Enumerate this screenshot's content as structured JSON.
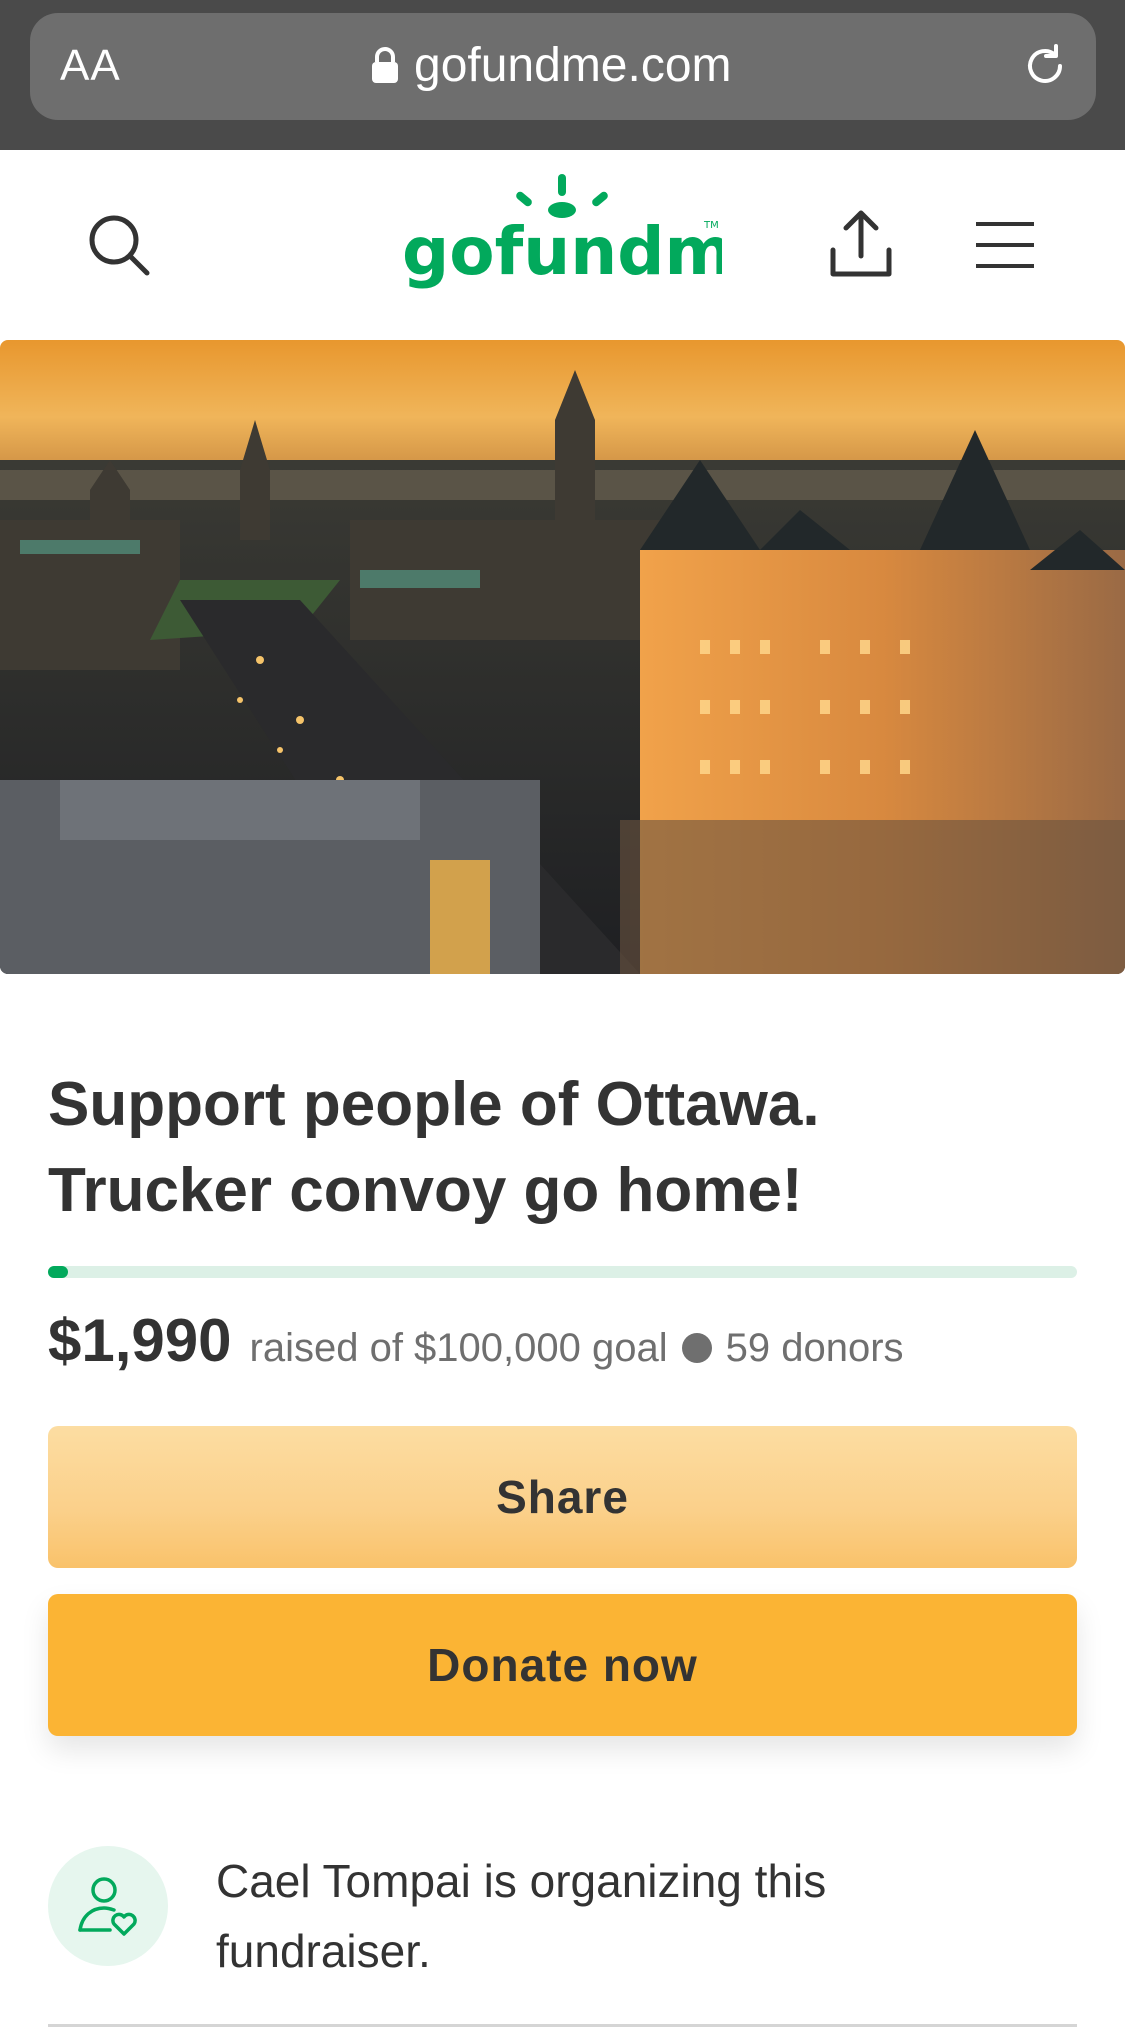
{
  "browser": {
    "text_size_label": "AA",
    "url": "gofundme.com"
  },
  "header": {
    "logo_text": "gofundme",
    "logo_tm": "TM",
    "brand_color": "#02a95c"
  },
  "campaign": {
    "title_line1": "Support people of Ottawa.",
    "title_line2": "Trucker convoy go home!",
    "amount_raised": "$1,990",
    "goal_text": "raised of $100,000 goal",
    "donors_text": "59 donors",
    "progress_fraction": 0.0199
  },
  "actions": {
    "share_label": "Share",
    "donate_label": "Donate now",
    "accent_color": "#fbb434"
  },
  "organizer": {
    "text": "Cael Tompai is organizing this fundraiser."
  },
  "icons": [
    "lock-icon",
    "reload-icon",
    "search-icon",
    "share-icon",
    "menu-icon",
    "organizer-heart-icon"
  ]
}
